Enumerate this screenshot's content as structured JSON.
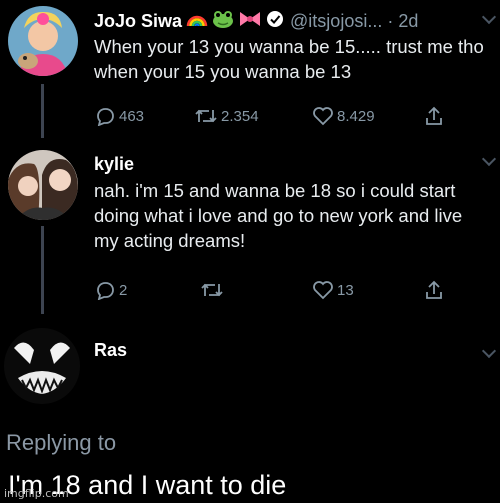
{
  "tweets": [
    {
      "name": "JoJo Siwa",
      "handle": "@itsjojosi...",
      "time": "· 2d",
      "text": "When your 13 you wanna be 15..... trust me tho when your 15 you wanna be 13",
      "emojis": [
        "rainbow-emoji",
        "frog-emoji",
        "bow-emoji",
        "verified-badge"
      ],
      "replies": "463",
      "retweets": "2.354",
      "likes": "8.429"
    },
    {
      "name": "kylie",
      "text": "nah. i'm 15 and wanna be 18 so i could start doing what i love and go to new york and live my acting dreams!",
      "replies": "2",
      "retweets": "",
      "likes": "13"
    },
    {
      "name": "Ras"
    }
  ],
  "replying_to": "Replying to",
  "final_text": "I'm 18 and I want to die",
  "watermark": "imgflip.com",
  "colors": {
    "background": "#000000",
    "text": "#e8ecef",
    "muted": "#8899a6",
    "thread_line": "#3d4451"
  }
}
